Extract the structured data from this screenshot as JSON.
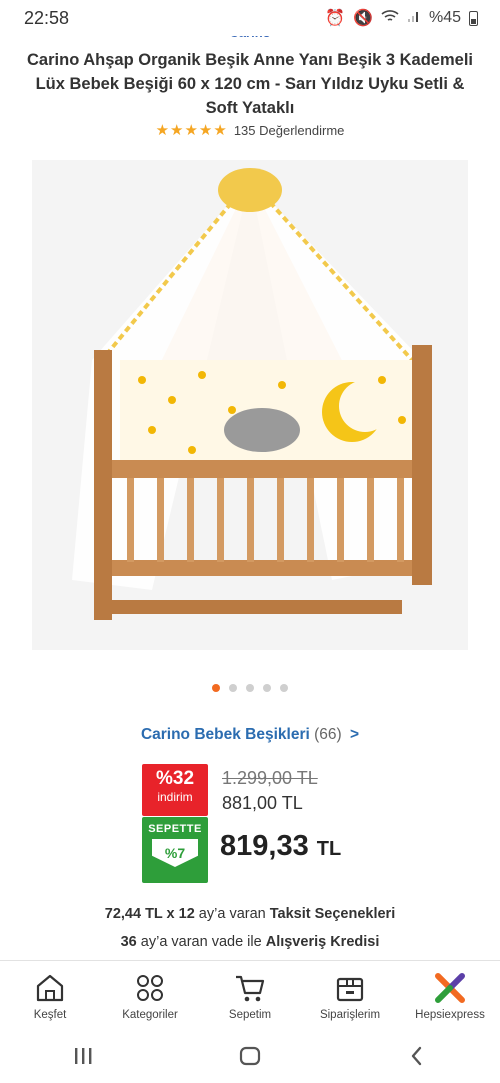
{
  "status": {
    "time": "22:58",
    "battery": "%45"
  },
  "brand_peek": "Carino",
  "product": {
    "title": "Carino Ahşap Organik Beşik Anne Yanı Beşik 3 Kademeli Lüx Bebek Beşiği 60 x 120 cm - Sarı Yıldız Uyku Setli & Soft Yataklı",
    "stars": "★★★★★",
    "rating_count": "135 Değerlendirme"
  },
  "gallery": {
    "active_index": 0,
    "total": 5
  },
  "brand_link": {
    "name": "Carino Bebek Beşikleri",
    "count": "(66)",
    "chevron": ">"
  },
  "price": {
    "discount_pct": "%32",
    "discount_label": "indirim",
    "old_price": "1.299,00 TL",
    "price": "881,00 TL",
    "basket_label": "SEPETTE",
    "basket_pct": "%7",
    "final_amount": "819,33",
    "final_currency": "TL"
  },
  "installment": {
    "amount": "72,44 TL x 12",
    "text": " ay’a varan ",
    "link": "Taksit Seçenekleri"
  },
  "credit": {
    "months": "36",
    "text": " ay’a varan vade ile ",
    "link": "Alışveriş Kredisi"
  },
  "tabs": [
    {
      "label": "Keşfet"
    },
    {
      "label": "Kategoriler"
    },
    {
      "label": "Sepetim"
    },
    {
      "label": "Siparişlerim"
    },
    {
      "label": "Hepsiexpress"
    }
  ],
  "colors": {
    "accent": "#f26a21",
    "discount": "#e8232a",
    "basket": "#2e9e3a",
    "link": "#2b6cb0"
  }
}
